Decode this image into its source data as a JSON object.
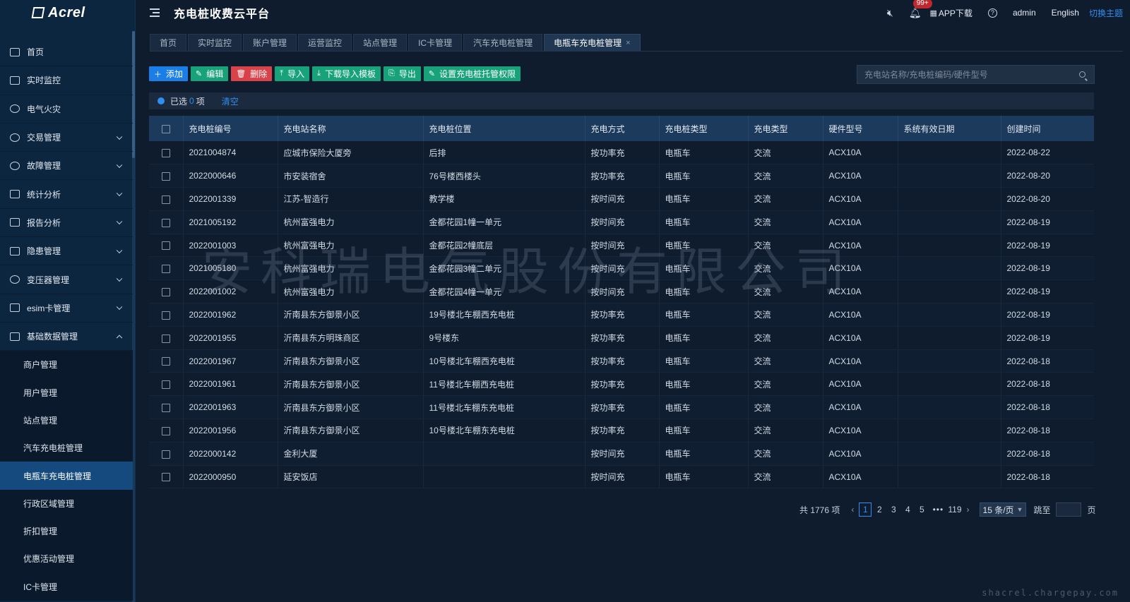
{
  "sidebar": {
    "logo": "Acrel",
    "items": [
      {
        "label": "首页",
        "icon": "monitor-icon",
        "expandable": false
      },
      {
        "label": "实时监控",
        "icon": "chart-monitor-icon",
        "expandable": false
      },
      {
        "label": "电气火灾",
        "icon": "fire-icon",
        "expandable": false
      },
      {
        "label": "交易管理",
        "icon": "transaction-icon",
        "expandable": true
      },
      {
        "label": "故障管理",
        "icon": "fault-icon",
        "expandable": true
      },
      {
        "label": "统计分析",
        "icon": "bar-chart-icon",
        "expandable": true
      },
      {
        "label": "报告分析",
        "icon": "report-icon",
        "expandable": true
      },
      {
        "label": "隐患管理",
        "icon": "warning-icon",
        "expandable": true
      },
      {
        "label": "变压器管理",
        "icon": "transformer-icon",
        "expandable": true
      },
      {
        "label": "esim卡管理",
        "icon": "sim-card-icon",
        "expandable": true
      },
      {
        "label": "基础数据管理",
        "icon": "database-icon",
        "expandable": true,
        "expanded": true
      }
    ],
    "subitems": [
      "商户管理",
      "用户管理",
      "站点管理",
      "汽车充电桩管理",
      "电瓶车充电桩管理",
      "行政区域管理",
      "折扣管理",
      "优惠活动管理",
      "IC卡管理"
    ],
    "active_subitem": "电瓶车充电桩管理"
  },
  "header": {
    "title": "充电桩收费云平台",
    "notification_count": "99+",
    "app_download": "APP下载",
    "user": "admin",
    "language": "English",
    "theme_switch": "切换主题"
  },
  "tabs": [
    {
      "label": "首页",
      "active": false
    },
    {
      "label": "实时监控",
      "active": false
    },
    {
      "label": "账户管理",
      "active": false
    },
    {
      "label": "运营监控",
      "active": false
    },
    {
      "label": "站点管理",
      "active": false
    },
    {
      "label": "IC卡管理",
      "active": false
    },
    {
      "label": "汽车充电桩管理",
      "active": false
    },
    {
      "label": "电瓶车充电桩管理",
      "active": true
    }
  ],
  "toolbar": {
    "add": "添加",
    "edit": "编辑",
    "delete": "删除",
    "import": "导入",
    "download_template": "下载导入模板",
    "export": "导出",
    "set_permission": "设置充电桩托管权限"
  },
  "search": {
    "placeholder": "充电站名称/充电桩编码/硬件型号"
  },
  "selection": {
    "prefix": "已选",
    "count": "0",
    "suffix": "项",
    "clear": "清空"
  },
  "table": {
    "columns": [
      "充电桩编号",
      "充电站名称",
      "充电桩位置",
      "充电方式",
      "充电桩类型",
      "充电类型",
      "硬件型号",
      "系统有效日期",
      "创建时间"
    ],
    "rows": [
      [
        "2021004874",
        "应城市保险大厦旁",
        "后排",
        "按功率充",
        "电瓶车",
        "交流",
        "ACX10A",
        "",
        "2022-08-22"
      ],
      [
        "2022000646",
        "市安装宿舍",
        "76号楼西楼头",
        "按功率充",
        "电瓶车",
        "交流",
        "ACX10A",
        "",
        "2022-08-20"
      ],
      [
        "2022001339",
        "江苏-智造行",
        "教学楼",
        "按时间充",
        "电瓶车",
        "交流",
        "ACX10A",
        "",
        "2022-08-20"
      ],
      [
        "2021005192",
        "杭州富强电力",
        "金都花园1幢一单元",
        "按时间充",
        "电瓶车",
        "交流",
        "ACX10A",
        "",
        "2022-08-19"
      ],
      [
        "2022001003",
        "杭州富强电力",
        "金都花园2幢底层",
        "按时间充",
        "电瓶车",
        "交流",
        "ACX10A",
        "",
        "2022-08-19"
      ],
      [
        "2021005180",
        "杭州富强电力",
        "金都花园3幢二单元",
        "按时间充",
        "电瓶车",
        "交流",
        "ACX10A",
        "",
        "2022-08-19"
      ],
      [
        "2022001002",
        "杭州富强电力",
        "金都花园4幢一单元",
        "按时间充",
        "电瓶车",
        "交流",
        "ACX10A",
        "",
        "2022-08-19"
      ],
      [
        "2022001962",
        "沂南县东方御景小区",
        "19号楼北车棚西充电桩",
        "按功率充",
        "电瓶车",
        "交流",
        "ACX10A",
        "",
        "2022-08-19"
      ],
      [
        "2022001955",
        "沂南县东方明珠商区",
        "9号楼东",
        "按功率充",
        "电瓶车",
        "交流",
        "ACX10A",
        "",
        "2022-08-19"
      ],
      [
        "2022001967",
        "沂南县东方御景小区",
        "10号楼北车棚西充电桩",
        "按功率充",
        "电瓶车",
        "交流",
        "ACX10A",
        "",
        "2022-08-18"
      ],
      [
        "2022001961",
        "沂南县东方御景小区",
        "11号楼北车棚西充电桩",
        "按功率充",
        "电瓶车",
        "交流",
        "ACX10A",
        "",
        "2022-08-18"
      ],
      [
        "2022001963",
        "沂南县东方御景小区",
        "11号楼北车棚东充电桩",
        "按功率充",
        "电瓶车",
        "交流",
        "ACX10A",
        "",
        "2022-08-18"
      ],
      [
        "2022001956",
        "沂南县东方御景小区",
        "10号楼北车棚东充电桩",
        "按功率充",
        "电瓶车",
        "交流",
        "ACX10A",
        "",
        "2022-08-18"
      ],
      [
        "2022000142",
        "金利大厦",
        "",
        "按时间充",
        "电瓶车",
        "交流",
        "ACX10A",
        "",
        "2022-08-18"
      ],
      [
        "2022000950",
        "延安饭店",
        "",
        "按时间充",
        "电瓶车",
        "交流",
        "ACX10A",
        "",
        "2022-08-18"
      ]
    ]
  },
  "pagination": {
    "total": "共 1776 项",
    "pages": [
      "1",
      "2",
      "3",
      "4",
      "5"
    ],
    "ellipsis": "•••",
    "last_page": "119",
    "page_size": "15 条/页",
    "jump_label": "跳至",
    "page_suffix": "页"
  },
  "watermark": "安科瑞电气股份有限公司",
  "site_watermark": "shacrel.chargepay.com"
}
